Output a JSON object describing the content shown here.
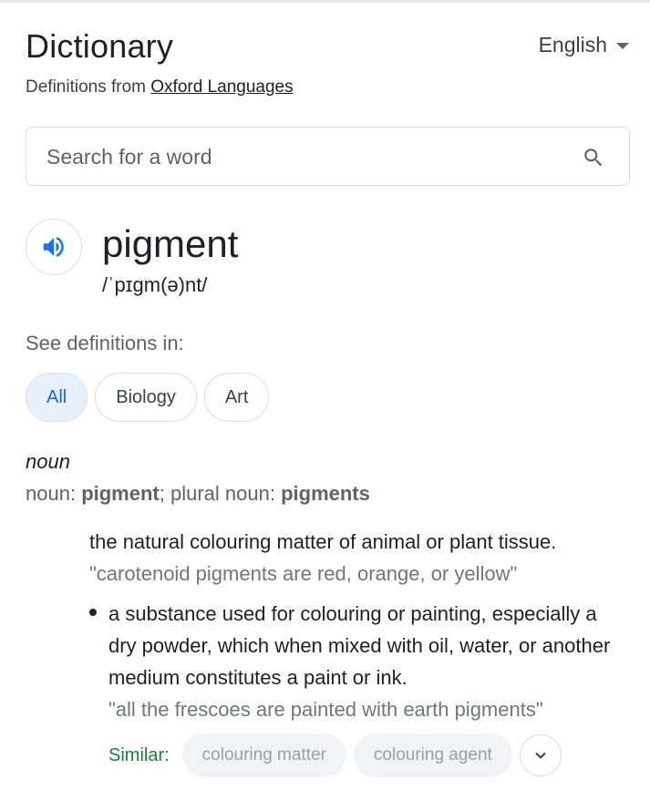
{
  "header": {
    "title": "Dictionary",
    "language": "English",
    "source_prefix": "Definitions from",
    "source_link": "Oxford Languages"
  },
  "search": {
    "placeholder": "Search for a word"
  },
  "entry": {
    "word": "pigment",
    "phonetic": "/ˈpɪɡm(ə)nt/"
  },
  "see_definitions": {
    "label": "See definitions in:",
    "chips": [
      "All",
      "Biology",
      "Art"
    ],
    "selected": "All"
  },
  "noun_block": {
    "part_of_speech": "noun",
    "forms_prefix": "noun:",
    "singular": "pigment",
    "plural_prefix": "; plural noun:",
    "plural": "pigments"
  },
  "definitions": [
    {
      "text": "the natural colouring matter of animal or plant tissue.",
      "example": "\"carotenoid pigments are red, orange, or yellow\""
    },
    {
      "text": "a substance used for colouring or painting, especially a dry powder, which when mixed with oil, water, or another medium constitutes a paint or ink.",
      "example": "\"all the frescoes are painted with earth pigments\""
    }
  ],
  "similar": {
    "label": "Similar:",
    "items": [
      "colouring matter",
      "colouring agent"
    ]
  },
  "colors": {
    "accent_blue": "#1a73e8",
    "similar_green": "#188038",
    "chip_active_bg": "#e8f0fe"
  },
  "icons": {
    "language_dropdown": "caret-down-icon",
    "search": "search-icon",
    "pronunciation": "speaker-icon",
    "expand": "chevron-down-icon"
  }
}
